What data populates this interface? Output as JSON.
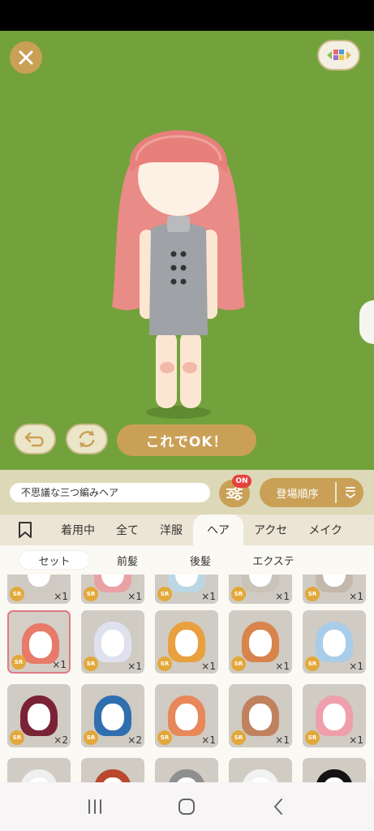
{
  "stage": {
    "ok_label": "これでOK！"
  },
  "filter": {
    "item_name": "不思議な三つ編みヘア",
    "settings_badge": "ON",
    "sort_label": "登場順序"
  },
  "category_tabs": [
    {
      "label": "着用中"
    },
    {
      "label": "全て"
    },
    {
      "label": "洋服"
    },
    {
      "label": "ヘア"
    },
    {
      "label": "アクセ"
    },
    {
      "label": "メイク"
    }
  ],
  "active_category": "ヘア",
  "sub_tabs": [
    {
      "label": "セット"
    },
    {
      "label": "前髪"
    },
    {
      "label": "後髪"
    },
    {
      "label": "エクステ"
    }
  ],
  "items": [
    {
      "rarity": "SR",
      "count": "×1",
      "hair_color": "#cfcac4"
    },
    {
      "rarity": "SR",
      "count": "×1",
      "hair_color": "#e9a2a4"
    },
    {
      "rarity": "SR",
      "count": "×1",
      "hair_color": "#bcd7e4"
    },
    {
      "rarity": "SR",
      "count": "×1",
      "hair_color": "#c9c3b8"
    },
    {
      "rarity": "SR",
      "count": "×1",
      "hair_color": "#c4b7ab"
    },
    {
      "rarity": "SR",
      "count": "×1",
      "hair_color": "#e87a6a"
    },
    {
      "rarity": "SR",
      "count": "×1",
      "hair_color": "#dfe2ee"
    },
    {
      "rarity": "SR",
      "count": "×1",
      "hair_color": "#e9a03f"
    },
    {
      "rarity": "SR",
      "count": "×1",
      "hair_color": "#d8844c"
    },
    {
      "rarity": "SR",
      "count": "×1",
      "hair_color": "#a9cde9"
    },
    {
      "rarity": "SR",
      "count": "×2",
      "hair_color": "#7a2236"
    },
    {
      "rarity": "SR",
      "count": "×2",
      "hair_color": "#2f6fb0"
    },
    {
      "rarity": "SR",
      "count": "×1",
      "hair_color": "#e8875a"
    },
    {
      "rarity": "SR",
      "count": "×1",
      "hair_color": "#c0825e"
    },
    {
      "rarity": "SR",
      "count": "×1",
      "hair_color": "#ef9fab"
    },
    {
      "rarity": "",
      "count": "",
      "hair_color": "#efefef"
    },
    {
      "rarity": "",
      "count": "",
      "hair_color": "#b8482e"
    },
    {
      "rarity": "",
      "count": "",
      "hair_color": "#8f8f8f"
    },
    {
      "rarity": "",
      "count": "",
      "hair_color": "#f2f2f2"
    },
    {
      "rarity": "",
      "count": "",
      "hair_color": "#141414"
    }
  ],
  "colors": {
    "stage_bg": "#73a23d",
    "accent_gold": "#c9a056",
    "badge_red": "#e4433d",
    "selected_border": "#e07a86"
  }
}
